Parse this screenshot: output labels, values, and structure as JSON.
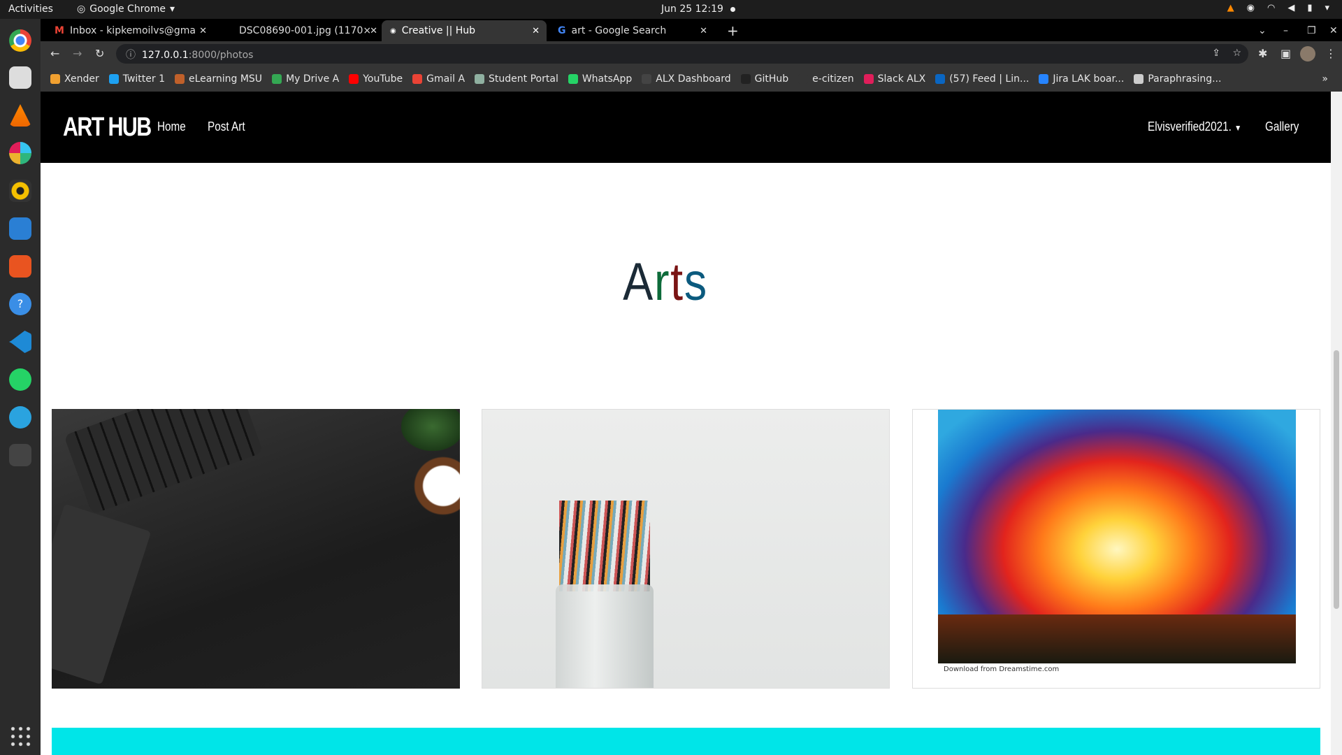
{
  "system": {
    "activities": "Activities",
    "app_name": "Google Chrome",
    "clock": "Jun 25  12:19"
  },
  "browser": {
    "tabs": [
      {
        "label": "Inbox - kipkemoilvs@gma",
        "icon": "gmail-icon"
      },
      {
        "label": "DSC08690-001.jpg (1170×",
        "icon": "image-icon"
      },
      {
        "label": "Creative || Hub",
        "icon": "site-icon",
        "active": true
      },
      {
        "label": "art - Google Search",
        "icon": "google-icon"
      }
    ],
    "url_host": "127.0.0.1",
    "url_rest": ":8000/photos",
    "bookmarks": [
      {
        "label": "Xender",
        "color": "#f0a030"
      },
      {
        "label": "Twitter 1",
        "color": "#1da1f2"
      },
      {
        "label": "eLearning MSU",
        "color": "#c0602a"
      },
      {
        "label": "My Drive A",
        "color": "#34a853"
      },
      {
        "label": "YouTube",
        "color": "#ff0000"
      },
      {
        "label": "Gmail A",
        "color": "#ea4335"
      },
      {
        "label": "Student Portal",
        "color": "#8fb0a0"
      },
      {
        "label": "WhatsApp",
        "color": "#25d366"
      },
      {
        "label": "ALX Dashboard",
        "color": "#444444"
      },
      {
        "label": "GitHub",
        "color": "#222222"
      },
      {
        "label": "e-citizen",
        "color": "#353535"
      },
      {
        "label": "Slack ALX",
        "color": "#e01e5a"
      },
      {
        "label": "(57) Feed | Lin...",
        "color": "#0a66c2"
      },
      {
        "label": "Jira LAK boar...",
        "color": "#2684ff"
      },
      {
        "label": "Paraphrasing...",
        "color": "#cccccc"
      }
    ],
    "bookmarks_overflow": "»"
  },
  "navbar": {
    "brand": "ART HUB",
    "home": "Home",
    "post_art": "Post Art",
    "user": "Elvisverified2021.",
    "gallery": "Gallery"
  },
  "page": {
    "title_letters": [
      {
        "ch": "A",
        "color": "#1b2a36"
      },
      {
        "ch": "r",
        "color": "#0d6b3a"
      },
      {
        "ch": "t",
        "color": "#7a1414"
      },
      {
        "ch": "s",
        "color": "#0b5a7e"
      }
    ],
    "accent": "#00e5e8",
    "image3_caption": "Download from Dreamstime.com"
  }
}
